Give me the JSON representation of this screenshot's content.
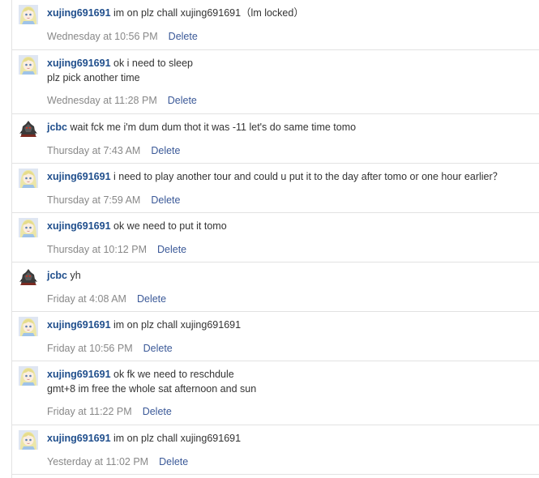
{
  "comments": [
    {
      "author": "xujing691691",
      "avatar": "girl-avatar",
      "lines": [
        "im on plz chall xujing691691（lm locked）"
      ],
      "time": "Wednesday at 10:56 PM",
      "delete_label": "Delete"
    },
    {
      "author": "xujing691691",
      "avatar": "girl-avatar",
      "lines": [
        "ok i need to sleep",
        "plz pick another time"
      ],
      "time": "Wednesday at 11:28 PM",
      "delete_label": "Delete"
    },
    {
      "author": "jcbc",
      "avatar": "robot-avatar",
      "lines": [
        "wait fck me i'm dum dum thot it was -11 let's do same time tomo"
      ],
      "time": "Thursday at 7:43 AM",
      "delete_label": "Delete"
    },
    {
      "author": "xujing691691",
      "avatar": "girl-avatar",
      "lines": [
        "i need to play another tour and could u put it to the day after tomo or one hour earlier？"
      ],
      "time": "Thursday at 7:59 AM",
      "delete_label": "Delete"
    },
    {
      "author": "xujing691691",
      "avatar": "girl-avatar",
      "lines": [
        "ok we need to put it tomo"
      ],
      "time": "Thursday at 10:12 PM",
      "delete_label": "Delete"
    },
    {
      "author": "jcbc",
      "avatar": "robot-avatar",
      "lines": [
        "yh"
      ],
      "time": "Friday at 4:08 AM",
      "delete_label": "Delete"
    },
    {
      "author": "xujing691691",
      "avatar": "girl-avatar",
      "lines": [
        "im on plz chall xujing691691"
      ],
      "time": "Friday at 10:56 PM",
      "delete_label": "Delete"
    },
    {
      "author": "xujing691691",
      "avatar": "girl-avatar",
      "lines": [
        "ok fk we need to reschdule",
        "gmt+8 im free the whole sat afternoon and sun"
      ],
      "time": "Friday at 11:22 PM",
      "delete_label": "Delete"
    },
    {
      "author": "xujing691691",
      "avatar": "girl-avatar",
      "lines": [
        "im on plz chall xujing691691"
      ],
      "time": "Yesterday at 11:02 PM",
      "delete_label": "Delete"
    }
  ]
}
